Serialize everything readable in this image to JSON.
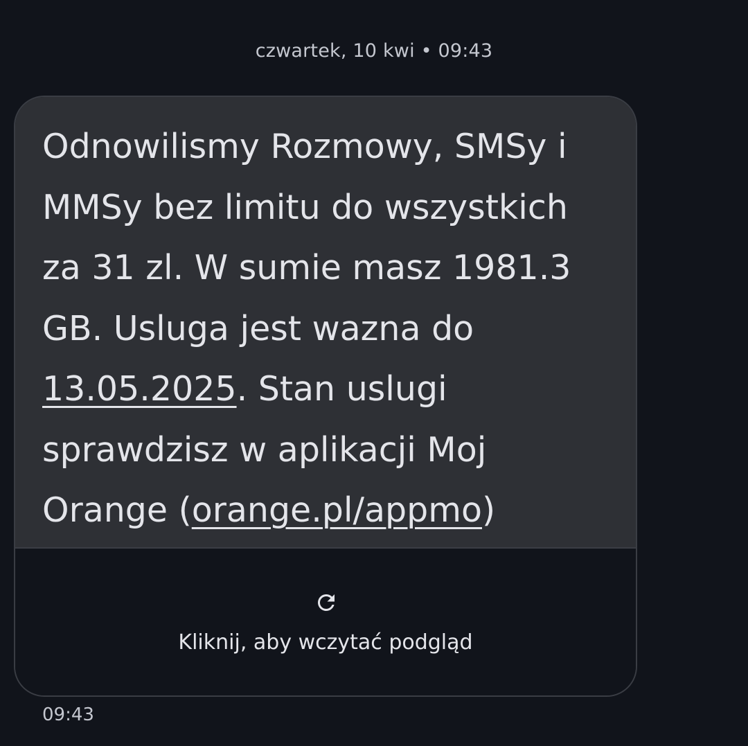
{
  "conversation": {
    "date_header": "czwartek, 10 kwi • 09:43"
  },
  "message": {
    "line1": "Odnowilismy Rozmowy, SMSy i",
    "line2": "MMSy bez limitu do wszystkich",
    "line3": "za 31 zl. W sumie masz 1981.3",
    "line4": "GB. Usluga jest wazna do",
    "line5_link": "13.05.2025",
    "line5_rest": ". Stan uslugi",
    "line6": "sprawdzisz w aplikacji Moj",
    "line7_prefix": "Orange (",
    "line7_link": "orange.pl/appmo",
    "line7_suffix": ")",
    "timestamp": "09:43"
  },
  "link_preview": {
    "icon": "reload-icon",
    "label": "Kliknij, aby wczytać podgląd"
  },
  "colors": {
    "background": "#11141b",
    "bubble": "#2e3035",
    "text": "#e4e5ea",
    "secondary_text": "#c4c7cf",
    "border": "#3a3d44"
  }
}
